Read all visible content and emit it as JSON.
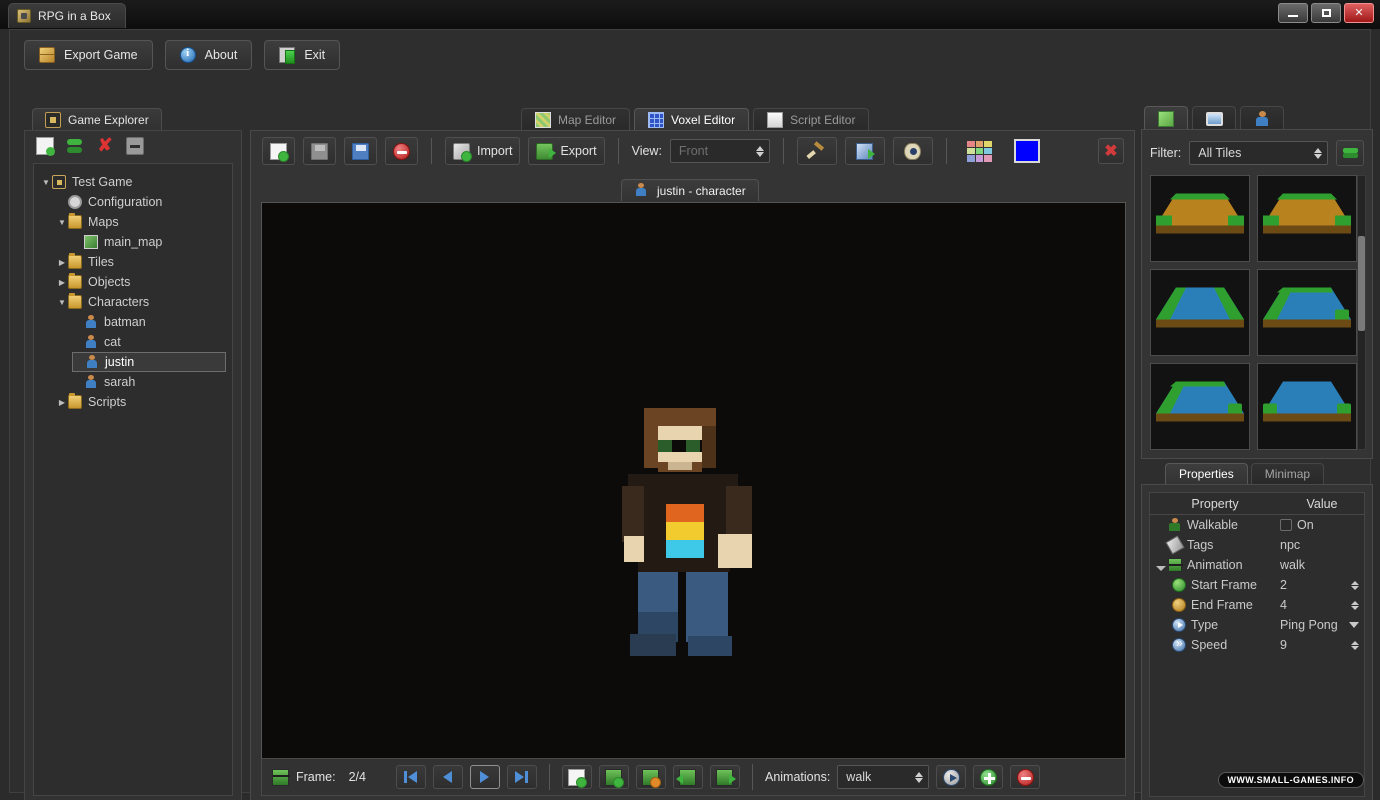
{
  "window": {
    "title": "RPG in a Box",
    "app_icon": "app-icon",
    "minimize_label": "",
    "maximize_label": "",
    "close_label": "✕"
  },
  "toolbar": {
    "buttons": [
      {
        "label": "Export Game",
        "icon": "package-box-icon"
      },
      {
        "label": "About",
        "icon": "info-circle-icon"
      },
      {
        "label": "Exit",
        "icon": "exit-door-icon"
      }
    ]
  },
  "explorer": {
    "tab_label": "Game Explorer",
    "tab_icon": "game-explorer-icon",
    "tools": [
      {
        "name": "new-item-icon"
      },
      {
        "name": "refresh-icon"
      },
      {
        "name": "delete-icon"
      },
      {
        "name": "collapse-all-icon"
      }
    ],
    "tree": [
      {
        "label": "Test Game",
        "icon": "project-icon",
        "depth": 0,
        "arrow": "down",
        "selected": false
      },
      {
        "label": "Configuration",
        "icon": "gear-icon",
        "depth": 1,
        "arrow": "none",
        "selected": false
      },
      {
        "label": "Maps",
        "icon": "folder-icon",
        "depth": 1,
        "arrow": "down",
        "selected": false
      },
      {
        "label": "main_map",
        "icon": "map-icon",
        "depth": 2,
        "arrow": "none",
        "selected": false
      },
      {
        "label": "Tiles",
        "icon": "folder-icon",
        "depth": 1,
        "arrow": "right",
        "selected": false
      },
      {
        "label": "Objects",
        "icon": "folder-icon",
        "depth": 1,
        "arrow": "right",
        "selected": false
      },
      {
        "label": "Characters",
        "icon": "folder-icon",
        "depth": 1,
        "arrow": "down",
        "selected": false
      },
      {
        "label": "batman",
        "icon": "character-icon",
        "depth": 2,
        "arrow": "none",
        "selected": false
      },
      {
        "label": "cat",
        "icon": "character-icon",
        "depth": 2,
        "arrow": "none",
        "selected": false
      },
      {
        "label": "justin",
        "icon": "character-icon",
        "depth": 2,
        "arrow": "none",
        "selected": true
      },
      {
        "label": "sarah",
        "icon": "character-icon",
        "depth": 2,
        "arrow": "none",
        "selected": false
      },
      {
        "label": "Scripts",
        "icon": "folder-icon",
        "depth": 1,
        "arrow": "right",
        "selected": false
      }
    ]
  },
  "editor_tabs": [
    {
      "label": "Map Editor",
      "icon": "map-editor-icon",
      "active": false
    },
    {
      "label": "Voxel Editor",
      "icon": "voxel-editor-icon",
      "active": true
    },
    {
      "label": "Script Editor",
      "icon": "script-editor-icon",
      "active": false
    }
  ],
  "voxel_toolbar": {
    "new_icon": "new-file-icon",
    "save_icon": "save-icon",
    "save_as_icon": "save-as-icon",
    "remove_icon": "remove-icon",
    "import_label": "Import",
    "import_icon": "import-icon",
    "export_label": "Export",
    "export_icon": "export-icon",
    "view_label": "View:",
    "view_value": "Front",
    "brush_icon": "paint-brush-icon",
    "fill_icon": "fill-tool-icon",
    "eye_icon": "visibility-eye-icon",
    "palette_icon": "color-palette-icon",
    "current_color": "#0000ff",
    "close_label": "✖"
  },
  "document_tab": {
    "label": "justin - character",
    "icon": "character-icon"
  },
  "playbar": {
    "frame_icon": "frame-icon",
    "frame_label": "Frame:",
    "frame_value": "2/4",
    "first_icon": "skip-to-first-icon",
    "prev_icon": "step-back-icon",
    "play_icon": "play-forward-icon",
    "last_icon": "skip-to-last-icon",
    "frame_new_icon": "new-frame-icon",
    "frame_add_icon": "add-frame-icon",
    "frame_delete_icon": "delete-frame-icon",
    "frame_move_left_icon": "move-frame-left-icon",
    "frame_move_right_icon": "move-frame-right-icon",
    "animations_label": "Animations:",
    "animations_value": "walk",
    "preview_icon": "preview-animation-icon",
    "add_animation_icon": "add-animation-icon",
    "remove_animation_icon": "remove-animation-icon"
  },
  "right_tabs": [
    {
      "icon": "tiles-tab-icon",
      "active": true
    },
    {
      "icon": "objects-tab-icon",
      "active": false
    },
    {
      "icon": "characters-tab-icon",
      "active": false
    }
  ],
  "assets": {
    "filter_label": "Filter:",
    "filter_value": "All Tiles",
    "refresh_icon": "refresh-assets-icon",
    "tiles": [
      {
        "name": "grass-dirt-tile-1",
        "kind": "dirt"
      },
      {
        "name": "grass-dirt-tile-2",
        "kind": "dirt"
      },
      {
        "name": "water-channel-tile",
        "kind": "water-both"
      },
      {
        "name": "water-bank-left-tile",
        "kind": "water-left"
      },
      {
        "name": "water-bank-left-tile-2",
        "kind": "water-left"
      },
      {
        "name": "water-open-tile",
        "kind": "water-open"
      }
    ]
  },
  "properties": {
    "tabs": [
      {
        "label": "Properties",
        "active": true
      },
      {
        "label": "Minimap",
        "active": false
      }
    ],
    "header": {
      "property": "Property",
      "value": "Value"
    },
    "rows": [
      {
        "name": "Walkable",
        "value": "On",
        "icon": "walkable-icon",
        "control": "checkbox",
        "checked": false,
        "indent": false,
        "expander": ""
      },
      {
        "name": "Tags",
        "value": "npc",
        "icon": "tag-icon",
        "control": "text",
        "indent": false,
        "expander": ""
      },
      {
        "name": "Animation",
        "value": "walk",
        "icon": "animation-icon",
        "control": "text",
        "indent": false,
        "expander": "down"
      },
      {
        "name": "Start Frame",
        "value": "2",
        "icon": "start-frame-icon",
        "control": "spinner",
        "indent": true,
        "expander": ""
      },
      {
        "name": "End Frame",
        "value": "4",
        "icon": "end-frame-icon",
        "control": "spinner",
        "indent": true,
        "expander": ""
      },
      {
        "name": "Type",
        "value": "Ping Pong",
        "icon": "loop-type-icon",
        "control": "dropdown",
        "indent": true,
        "expander": ""
      },
      {
        "name": "Speed",
        "value": "9",
        "icon": "speed-icon",
        "control": "spinner",
        "indent": true,
        "expander": ""
      }
    ]
  },
  "watermark": {
    "text": "WWW.SMALL-GAMES.INFO"
  }
}
